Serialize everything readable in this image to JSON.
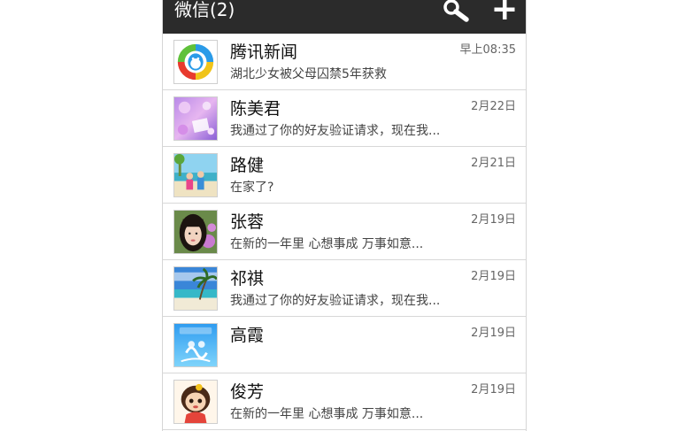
{
  "header": {
    "title": "微信(2)",
    "search_icon": "search-icon",
    "add_icon": "plus-icon",
    "background": "#2b2b2b"
  },
  "chats": [
    {
      "name": "腾讯新闻",
      "message": "湖北少女被父母囚禁5年获救",
      "time": "早上08:35",
      "avatar": "tencent-news-logo"
    },
    {
      "name": "陈美君",
      "message": "我通过了你的好友验证请求，现在我...",
      "time": "2月22日",
      "avatar": "purple-floral-photo"
    },
    {
      "name": "路健",
      "message": "在家了?",
      "time": "2月21日",
      "avatar": "beach-couple-photo"
    },
    {
      "name": "张蓉",
      "message": "在新的一年里  心想事成  万事如意...",
      "time": "2月19日",
      "avatar": "girl-portrait-photo"
    },
    {
      "name": "祁祺",
      "message": "我通过了你的好友验证请求，现在我...",
      "time": "2月19日",
      "avatar": "tropical-beach-photo"
    },
    {
      "name": "高霞",
      "message": "",
      "time": "2月19日",
      "avatar": "blue-cartoon-image"
    },
    {
      "name": "俊芳",
      "message": "在新的一年里  心想事成  万事如意...",
      "time": "2月19日",
      "avatar": "cartoon-girl-image"
    }
  ]
}
